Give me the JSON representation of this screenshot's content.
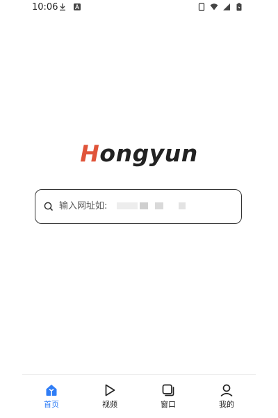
{
  "status_bar": {
    "time": "10:06",
    "icons": [
      "download-icon",
      "app-notification-icon",
      "phone-outline-icon",
      "wifi-icon",
      "cellular-signal-icon",
      "battery-icon"
    ]
  },
  "brand": {
    "initial": "H",
    "rest": "ongyun",
    "accent_color": "#e0543a",
    "text_color": "#222222"
  },
  "search": {
    "placeholder": "输入网址如:",
    "icon": "search-icon"
  },
  "bottom_nav": {
    "active_color": "#2f7df6",
    "items": [
      {
        "label": "首页",
        "icon": "home-icon",
        "active": true
      },
      {
        "label": "视频",
        "icon": "play-icon",
        "active": false
      },
      {
        "label": "窗口",
        "icon": "windows-icon",
        "active": false
      },
      {
        "label": "我的",
        "icon": "user-icon",
        "active": false
      }
    ]
  }
}
